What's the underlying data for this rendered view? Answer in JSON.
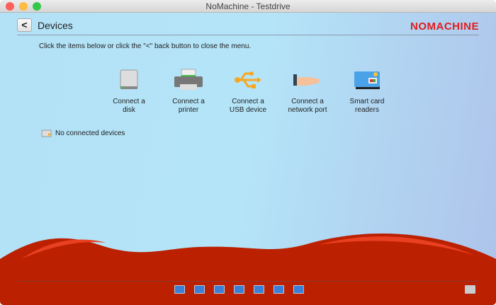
{
  "window": {
    "title": "NoMachine - Testdrive"
  },
  "header": {
    "back_label": "<",
    "title": "Devices",
    "logo": "NOMACHINE"
  },
  "hint": "Click the items below or click the \"<\" back button to close the menu.",
  "items": [
    {
      "line1": "Connect a",
      "line2": "disk"
    },
    {
      "line1": "Connect a",
      "line2": "printer"
    },
    {
      "line1": "Connect a",
      "line2": "USB device"
    },
    {
      "line1": "Connect a",
      "line2": "network port"
    },
    {
      "line1": "Smart card",
      "line2": "readers"
    }
  ],
  "status": "No connected devices",
  "colors": {
    "accent": "#e01e1e",
    "footer": "#bb2000"
  }
}
